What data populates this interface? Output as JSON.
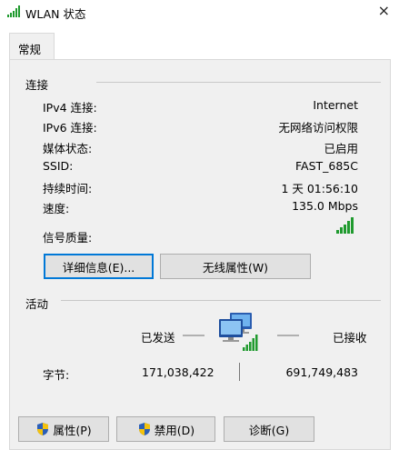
{
  "window": {
    "title": "WLAN 状态",
    "close_glyph": "×"
  },
  "tabs": [
    {
      "label": "常规"
    }
  ],
  "connection": {
    "section_title": "连接",
    "rows": [
      {
        "label": "IPv4 连接:",
        "value": "Internet"
      },
      {
        "label": "IPv6 连接:",
        "value": "无网络访问权限"
      },
      {
        "label": "媒体状态:",
        "value": "已启用"
      },
      {
        "label": "SSID:",
        "value": "FAST_685C"
      },
      {
        "label": "持续时间:",
        "value": "1 天 01:56:10"
      },
      {
        "label": "速度:",
        "value": "135.0 Mbps"
      }
    ],
    "signal_label": "信号质量:",
    "signal_icon": "signal-bars-icon",
    "signal_level": 5,
    "signal_max": 5,
    "details_button": "详细信息(E)...",
    "wireless_props_button": "无线属性(W)"
  },
  "activity": {
    "section_title": "活动",
    "sent_label": "已发送",
    "received_label": "已接收",
    "network_icon": "network-computers-icon",
    "bytes_label": "字节:",
    "bytes_sent": "171,038,422",
    "bytes_received": "691,749,483"
  },
  "buttons": {
    "properties": "属性(P)",
    "disable": "禁用(D)",
    "diagnose": "诊断(G)"
  },
  "colors": {
    "signal_green": "#1f9a2e",
    "focus_blue": "#0078d7",
    "shield_blue": "#2b5fb8",
    "shield_yellow": "#f4c20d"
  }
}
